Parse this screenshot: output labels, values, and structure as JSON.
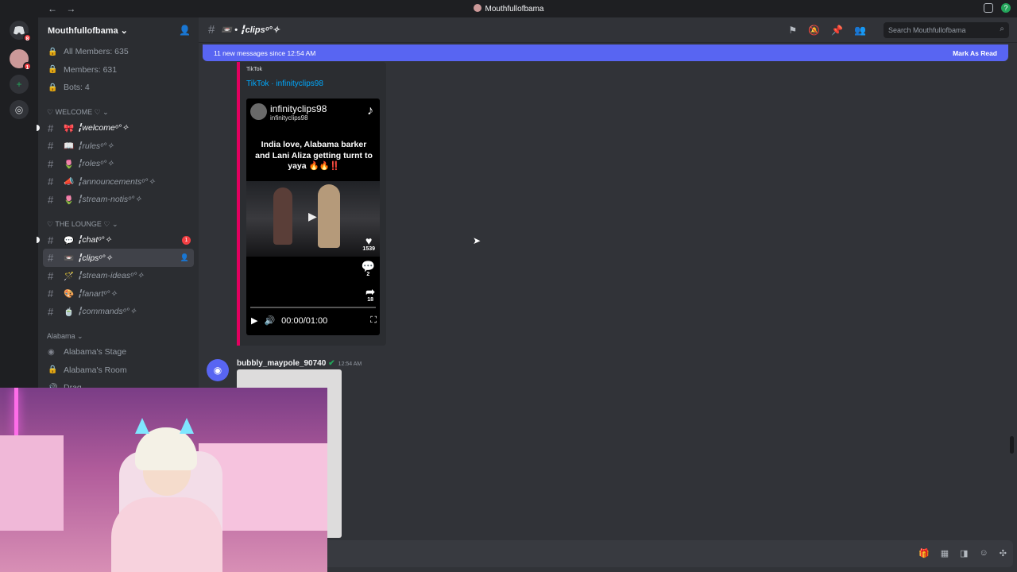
{
  "titlebar": {
    "back": "←",
    "forward": "→",
    "title": "Mouthfullofbama"
  },
  "rail": {
    "home_badge": "8",
    "server_badge": "1"
  },
  "server": {
    "name": "Mouthfullofbama ⌄"
  },
  "stats": [
    "All Members: 635",
    "Members: 631",
    "Bots: 4"
  ],
  "categories": {
    "welcome": "♡ WELCOME ♡ ⌄",
    "lounge": "♡ THE LOUNGE ♡ ⌄",
    "alabama": "Alabama ⌄"
  },
  "welcome_channels": [
    {
      "emoji": "🎀",
      "label": "╏welcomeᵒ°✧"
    },
    {
      "emoji": "📖",
      "label": "╏rulesᵒ°✧"
    },
    {
      "emoji": "🌷",
      "label": "╏rolesᵒ°✧"
    },
    {
      "emoji": "📣",
      "label": "╏announcementsᵒ°✧"
    },
    {
      "emoji": "🌷",
      "label": "╏stream-notisᵒ°✧"
    }
  ],
  "lounge_channels": [
    {
      "emoji": "💬",
      "label": "╏chatᵒ°✧",
      "badge": "1"
    },
    {
      "emoji": "📼",
      "label": "╏clipsᵒ°✧"
    },
    {
      "emoji": "🪄",
      "label": "╏stream-ideasᵒ°✧"
    },
    {
      "emoji": "🎨",
      "label": "╏fanartᵒ°✧"
    },
    {
      "emoji": "🍵",
      "label": "╏commandsᵒ°✧"
    }
  ],
  "alabama_channels": [
    "Alabama's Stage",
    "Alabama's Room",
    "Drag"
  ],
  "channel_header": {
    "name": "📼 • ╏clipsᵒ°✧",
    "search_placeholder": "Search Mouthfullofbama"
  },
  "banner": {
    "text": "11 new messages since 12:54 AM",
    "action": "Mark As Read"
  },
  "embed": {
    "provider": "TikTok",
    "link": "TikTok · infinityclips98",
    "username": "infinityclips98",
    "handle": "infinityclips98",
    "caption": "India love, Alabama barker and Lani Aliza getting turnt to yaya 🔥🔥‼️",
    "likes": "1539",
    "comments": "2",
    "shares": "18",
    "time": "00:00/01:00"
  },
  "message": {
    "author": "bubbly_maypole_90740",
    "time": "12:54 AM"
  }
}
